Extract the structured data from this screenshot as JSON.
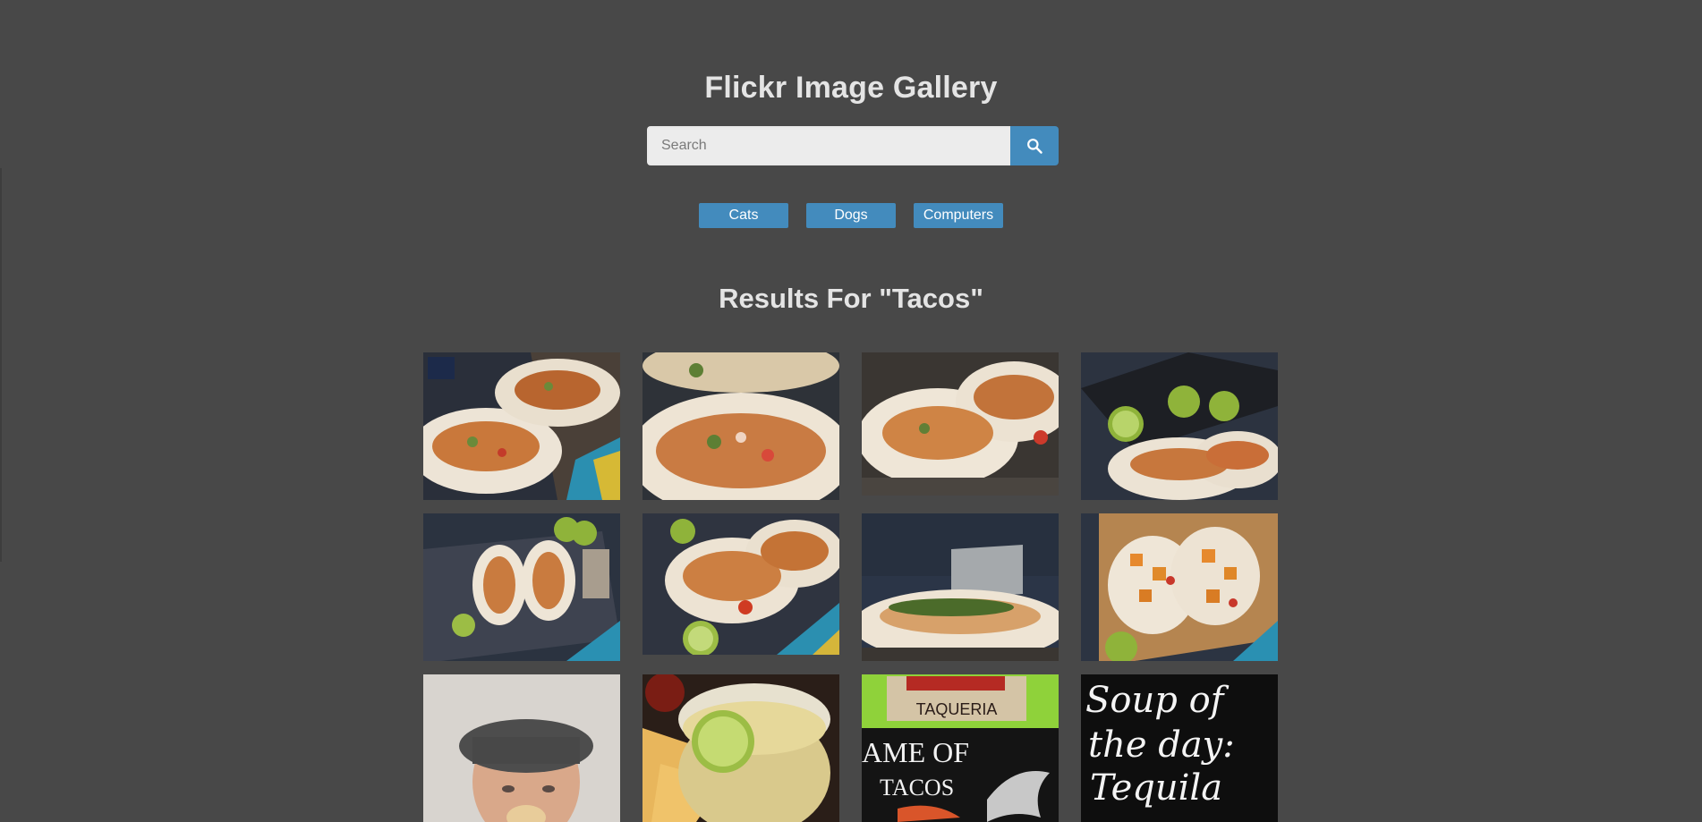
{
  "header": {
    "title": "Flickr Image Gallery"
  },
  "search": {
    "placeholder": "Search",
    "value": "",
    "button_icon": "search-icon"
  },
  "nav": {
    "items": [
      {
        "label": "Cats"
      },
      {
        "label": "Dogs"
      },
      {
        "label": "Computers"
      }
    ]
  },
  "results": {
    "heading": "Results For \"Tacos\""
  },
  "gallery": {
    "photos": [
      {
        "subject": "tacos-on-board"
      },
      {
        "subject": "taco-closeup"
      },
      {
        "subject": "tacos-in-holder"
      },
      {
        "subject": "tacos-with-limes"
      },
      {
        "subject": "tacos-on-tray-overhead"
      },
      {
        "subject": "tacos-with-lime-wedge"
      },
      {
        "subject": "taco-in-holder-closeup"
      },
      {
        "subject": "tacos-with-squash"
      },
      {
        "subject": "man-eating-taco"
      },
      {
        "subject": "margarita-with-chips"
      },
      {
        "subject": "taqueria-chalkboard-sign"
      },
      {
        "subject": "chalkboard-soup-of-the-day"
      }
    ],
    "photo_text": {
      "taqueria": "TAQUERIA",
      "game_of": "AME OF",
      "tacos": "TACOS",
      "soup_line1": "Soup of",
      "soup_line2": "the day:",
      "soup_line3": "Tequila"
    }
  },
  "colors": {
    "background": "#484848",
    "accent": "#438bbd",
    "title_text": "#e4e4e4"
  }
}
